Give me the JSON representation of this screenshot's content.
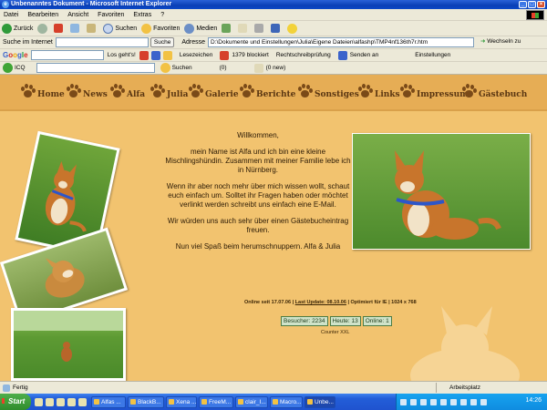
{
  "window": {
    "title": "Unbenanntes Dokument - Microsoft Internet Explorer"
  },
  "menu": [
    "Datei",
    "Bearbeiten",
    "Ansicht",
    "Favoriten",
    "Extras",
    "?"
  ],
  "toolbar": {
    "back": "Zurück",
    "search": "Suchen",
    "favorites": "Favoriten",
    "media": "Medien"
  },
  "address_row": {
    "search_label": "Suche im Internet",
    "search_button": "Suche",
    "address_label": "Adresse",
    "url": "D:\\Dokumente und Einstellungen\\Julia\\Eigene Dateien\\alfashp\\TMP4nf136th7r.htm",
    "go_button": "Wechseln zu"
  },
  "google_bar": {
    "logo": [
      "G",
      "o",
      "o",
      "g",
      "l",
      "e"
    ],
    "search_prompt": "Los geht's!",
    "bookmarks": "Lesezeichen",
    "blocked": "1379 blockiert",
    "spellcheck": "Rechtschreibprüfung",
    "send": "Senden an",
    "settings": "Einstellungen"
  },
  "icq_bar": {
    "icq": "ICQ",
    "search": "Suchen",
    "counter": "(0)",
    "news": "(0 new)"
  },
  "site": {
    "nav": [
      "Home",
      "News",
      "Alfa",
      "Julia",
      "Galerie",
      "Berichte",
      "Sonstiges",
      "Links",
      "Impressum",
      "Gästebuch"
    ],
    "welcome": {
      "title": "Willkommen,",
      "para1": "mein Name ist Alfa und ich bin eine kleine Mischlingshündin. Zusammen mit meiner Familie lebe ich in Nürnberg.",
      "para2": "Wenn ihr aber noch mehr über mich wissen wollt, schaut euch einfach um. Solltet ihr Fragen haben oder möchtet verlinkt werden schreibt uns einfach eine E-Mail.",
      "para3": "Wir würden uns auch sehr über einen Gästebucheintrag freuen.",
      "para4": "Nun viel Spaß beim herumschnuppern. Alfa & Julia"
    },
    "footer": {
      "online_since": "Online seit 17.07.06 |",
      "last_update": "Last Update: 08.10.06",
      "optimized": "| Optimiert für IE | 1024 x 768"
    },
    "counter": {
      "visitors": "Besucher: 2234",
      "today": "Heute: 13",
      "online": "Online: 1",
      "brand": "Counter XXL"
    }
  },
  "status": {
    "left": "Fertig",
    "zone": "Arbeitsplatz"
  },
  "taskbar": {
    "start": "Start",
    "tasks": [
      "Alfas ...",
      "BlackB...",
      "Xena ...",
      "FreeM...",
      "clair_I...",
      "Macro...",
      "Unbe..."
    ],
    "clock": "14:26"
  },
  "colors": {
    "page_bg": "#f2c36f",
    "nav_bg": "#e6ad55",
    "nav_text": "#5a3612",
    "counter_bg": "#cfe3c9"
  }
}
